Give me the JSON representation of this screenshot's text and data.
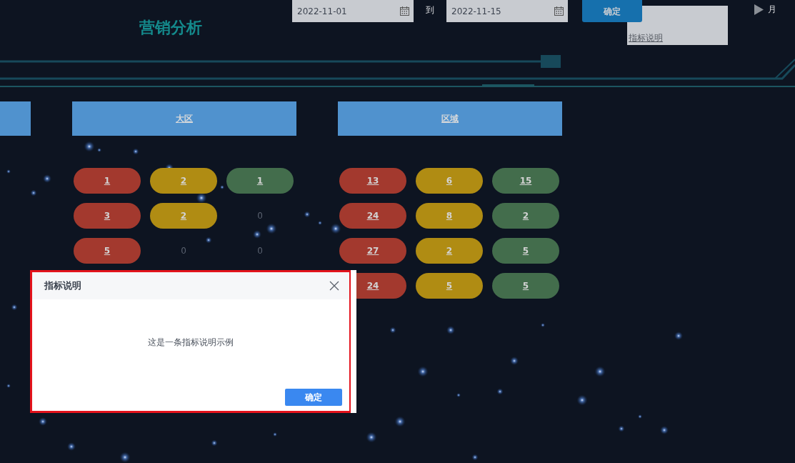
{
  "title": "营销分析",
  "date_range": {
    "start": "2022-11-01",
    "separator": "到",
    "end": "2022-11-15"
  },
  "confirm_button": "确定",
  "info_link": "指标说明",
  "period_toggle": {
    "label": "月"
  },
  "groups": [
    {
      "kind": "partial"
    },
    {
      "kind": "full",
      "label": "大区",
      "rows": [
        [
          {
            "value": "1",
            "color": "#a3392e"
          },
          {
            "value": "2",
            "color": "#b08c13"
          },
          {
            "value": "1",
            "color": "#436d4c"
          }
        ],
        [
          {
            "value": "3",
            "color": "#a3392e"
          },
          {
            "value": "2",
            "color": "#b08c13"
          },
          {
            "value": "0"
          }
        ],
        [
          {
            "value": "5",
            "color": "#a3392e"
          },
          {
            "value": "0"
          },
          {
            "value": "0"
          }
        ]
      ]
    },
    {
      "kind": "full",
      "label": "区域",
      "rows": [
        [
          {
            "value": "13",
            "color": "#a3392e"
          },
          {
            "value": "6",
            "color": "#b08c13"
          },
          {
            "value": "15",
            "color": "#436d4c"
          }
        ],
        [
          {
            "value": "24",
            "color": "#a3392e"
          },
          {
            "value": "8",
            "color": "#b08c13"
          },
          {
            "value": "2",
            "color": "#436d4c"
          }
        ],
        [
          {
            "value": "27",
            "color": "#a3392e"
          },
          {
            "value": "2",
            "color": "#b08c13"
          },
          {
            "value": "5",
            "color": "#436d4c"
          }
        ],
        [
          {
            "value": "24",
            "color": "#a3392e"
          },
          {
            "value": "5",
            "color": "#b08c13"
          },
          {
            "value": "5",
            "color": "#436d4c"
          }
        ]
      ]
    }
  ],
  "modal": {
    "title": "指标说明",
    "message": "这是一条指标说明示例",
    "ok_button": "确定"
  }
}
